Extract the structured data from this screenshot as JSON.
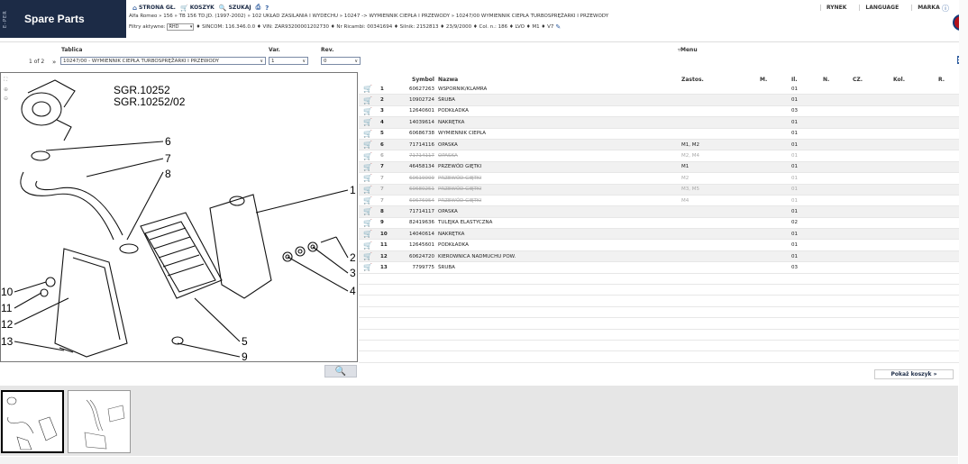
{
  "header": {
    "eper_label": "E-PER",
    "app_title": "Spare Parts",
    "nav": [
      {
        "label": "STRONA GŁ."
      },
      {
        "label": "KOSZYK"
      },
      {
        "label": "SZUKAJ"
      }
    ],
    "breadcrumb": "Alfa Romeo » 156 » TB 156 TD.JD. (1997-2002) » 102 UKŁAD ZASILANIA I WYDECHU » 10247 -> WYMIENNIK CIEPŁA I PRZEWODY » 10247/00 WYMIENNIK CIEPŁA TURBOSPRĘŻARKI I PRZEWODY",
    "filters_label": "Filtry aktywne:",
    "filters_select": "RHD",
    "filters_text": "♦ SINCOM: 116.346.0.0 ♦ VIN: ZAR93200001202730 ♦ Nr Ricambi: 00341694 ♦ Silnik: 2152813 ♦ 23/9/2000 ♦ Col. n.: 186 ♦ LVO ♦ M1 ♦ V7",
    "right_nav": [
      "RYNEK",
      "LANGUAGE",
      "MARKA"
    ]
  },
  "toolbar": {
    "tablica_label": "Tablica",
    "var_label": "Var.",
    "rev_label": "Rev.",
    "page_count": "1 of 2",
    "tablica_value": "10247/00 - WYMIENNIK CIEPŁA TURBOSPRĘŻARKI I PRZEWODY",
    "var_value": "1",
    "rev_value": "0",
    "menu_label": "Menu"
  },
  "diagram": {
    "labels": [
      "SGR.10252",
      "SGR.10252/02"
    ],
    "callouts": [
      "1",
      "2",
      "3",
      "4",
      "5",
      "6",
      "7",
      "8",
      "9",
      "10",
      "11",
      "12",
      "13"
    ]
  },
  "table": {
    "headers": {
      "symbol": "Symbol",
      "nazwa": "Nazwa",
      "zastos": "Zastos.",
      "m": "M.",
      "il": "Il.",
      "n": "N.",
      "cz": "CZ.",
      "kol": "Kol.",
      "r": "R."
    },
    "rows": [
      {
        "no": "1",
        "symbol": "60627263",
        "name": "WSPORNIK/KLAMRA",
        "app": "",
        "il": "01",
        "cart": "blue",
        "struck": false
      },
      {
        "no": "2",
        "symbol": "10902724",
        "name": "ŚRUBA",
        "app": "",
        "il": "01",
        "cart": "blue",
        "struck": false
      },
      {
        "no": "3",
        "symbol": "12640601",
        "name": "PODKŁADKA",
        "app": "",
        "il": "03",
        "cart": "blue",
        "struck": false
      },
      {
        "no": "4",
        "symbol": "14039614",
        "name": "NAKRĘTKA",
        "app": "",
        "il": "01",
        "cart": "blue",
        "struck": false
      },
      {
        "no": "5",
        "symbol": "60686738",
        "name": "WYMIENNIK CIEPŁA",
        "app": "",
        "il": "01",
        "cart": "blue",
        "struck": false
      },
      {
        "no": "6",
        "symbol": "71714116",
        "name": "OPASKA",
        "app": "M1, M2",
        "il": "01",
        "cart": "blue",
        "struck": false
      },
      {
        "no": "6",
        "symbol": "71714117",
        "name": "OPASKA",
        "app": "M2, M4",
        "il": "01",
        "cart": "blue",
        "struck": true
      },
      {
        "no": "7",
        "symbol": "46458134",
        "name": "PRZEWÓD GIĘTKI",
        "app": "M1",
        "il": "01",
        "cart": "red",
        "struck": false
      },
      {
        "no": "7",
        "symbol": "60619009",
        "name": "PRZEWÓD GIĘTKI",
        "app": "M2",
        "il": "01",
        "cart": "red",
        "struck": true
      },
      {
        "no": "7",
        "symbol": "60680251",
        "name": "PRZEWÓD GIĘTKI",
        "app": "M3, M5",
        "il": "01",
        "cart": "blue",
        "struck": true
      },
      {
        "no": "7",
        "symbol": "60676954",
        "name": "PRZEWÓD GIĘTKI",
        "app": "M4",
        "il": "01",
        "cart": "blue",
        "struck": true
      },
      {
        "no": "8",
        "symbol": "71714117",
        "name": "OPASKA",
        "app": "",
        "il": "01",
        "cart": "blue",
        "struck": false
      },
      {
        "no": "9",
        "symbol": "82419636",
        "name": "TULEJKA ELASTYCZNA",
        "app": "",
        "il": "02",
        "cart": "blue",
        "struck": false
      },
      {
        "no": "10",
        "symbol": "14040614",
        "name": "NAKRĘTKA",
        "app": "",
        "il": "01",
        "cart": "blue",
        "struck": false
      },
      {
        "no": "11",
        "symbol": "12645601",
        "name": "PODKŁADKA",
        "app": "",
        "il": "01",
        "cart": "blue",
        "struck": false
      },
      {
        "no": "12",
        "symbol": "60624720",
        "name": "KIEROWNICA NADMUCHU POW.",
        "app": "",
        "il": "01",
        "cart": "blue",
        "struck": false
      },
      {
        "no": "13",
        "symbol": "7799775",
        "name": "ŚRUBA",
        "app": "",
        "il": "03",
        "cart": "blue",
        "struck": false
      }
    ]
  },
  "cart_button": "Pokaż koszyk »",
  "colors": {
    "brand": "#1c2b46",
    "accent": "#2f5d9f",
    "alt_row": "#f1f1f1",
    "red_cart": "#c0142a"
  }
}
